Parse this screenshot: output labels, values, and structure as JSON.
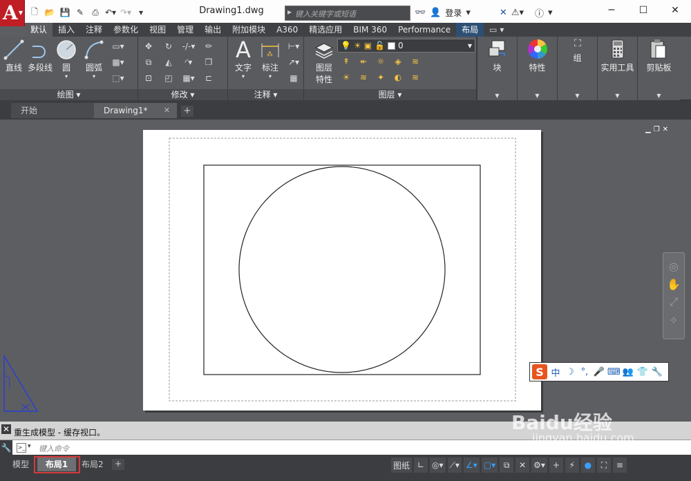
{
  "app": {
    "logo_letter": "A",
    "document_title": "Drawing1.dwg",
    "search_placeholder": "键入关键字或短语",
    "login_label": "登录",
    "help_label": "?"
  },
  "ribbon_tabs": [
    "默认",
    "插入",
    "注释",
    "参数化",
    "视图",
    "管理",
    "输出",
    "附加模块",
    "A360",
    "精选应用",
    "BIM 360",
    "Performance",
    "布局"
  ],
  "ribbon_tab_extra": "▭ ▾",
  "ribbon": {
    "draw": {
      "tools": [
        "直线",
        "多段线",
        "圆",
        "圆弧"
      ],
      "label": "绘图 ▾"
    },
    "modify": {
      "label": "修改 ▾"
    },
    "annotation": {
      "tools": [
        "文字",
        "标注"
      ],
      "label": "注释 ▾"
    },
    "layers": {
      "current_layer": "0",
      "properties_label_1": "图层",
      "properties_label_2": "特性",
      "label": "图层 ▾"
    },
    "right_panels": [
      {
        "label": "块",
        "icon": "block-icon"
      },
      {
        "label": "特性",
        "icon": "color-wheel-icon"
      },
      {
        "label": "组",
        "icon": "group-icon"
      },
      {
        "label": "实用工具",
        "icon": "calculator-icon"
      },
      {
        "label": "剪贴板",
        "icon": "clipboard-icon"
      }
    ]
  },
  "file_tabs": {
    "start": "开始",
    "current": "Drawing1*",
    "close": "✕",
    "add": "+"
  },
  "ime_bar": {
    "logo": "S",
    "items": [
      "中",
      "☽",
      "°,",
      "🎤",
      "⌨",
      "👥",
      "👕",
      "🔧"
    ]
  },
  "command": {
    "history": "重生成模型 - 缓存视口。",
    "placeholder": "键入命令"
  },
  "layout_tabs": {
    "model": "模型",
    "layout1": "布局1",
    "layout2": "布局2",
    "add": "+"
  },
  "status": {
    "paper_label": "图纸"
  },
  "watermark": {
    "text": "Baidu经验",
    "url": "jingyan.baidu.com"
  },
  "colors": {
    "accent_red": "#c01e25",
    "layout_tab_blue": "#2d4f73",
    "highlight": "#d9393a",
    "ucs_blue": "#2a3fd1"
  }
}
